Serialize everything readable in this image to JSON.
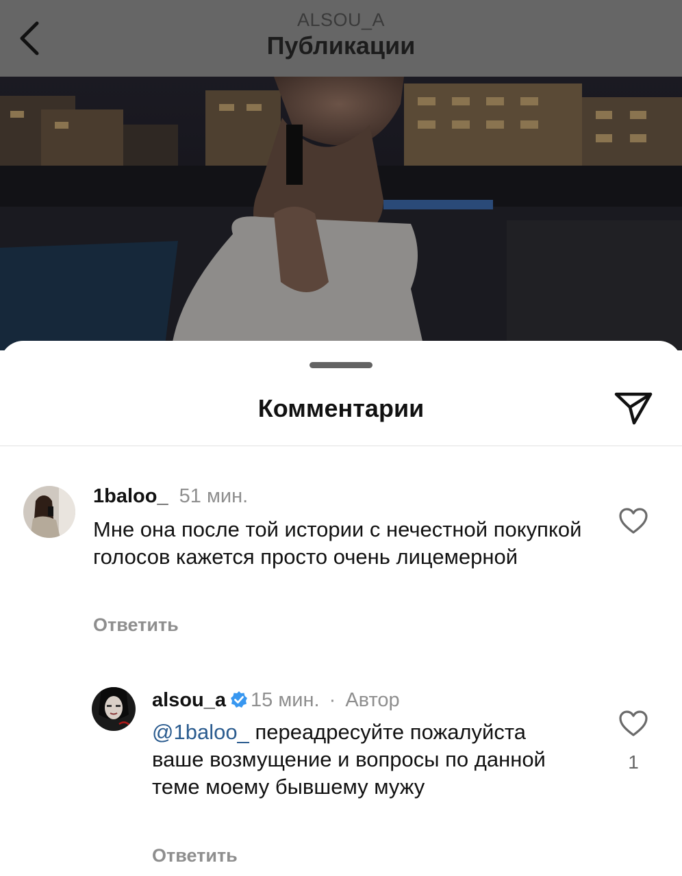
{
  "header": {
    "username": "ALSOU_A",
    "title": "Публикации"
  },
  "sheet": {
    "title": "Комментарии"
  },
  "comments": [
    {
      "username": "1baloo_",
      "time": "51 мин.",
      "text": "Мне она после той истории с нечестной покупкой голосов кажется просто очень лицемерной",
      "reply_label": "Ответить",
      "icon": "heart-outline-icon"
    }
  ],
  "replies": [
    {
      "username": "alsou_a",
      "verified": true,
      "time": "15 мин.",
      "separator": "·",
      "badge": "Автор",
      "mention": "@1baloo_",
      "text": "переадресуйте пожалуйста ваше возмущение и вопросы по данной теме моему бывшему мужу",
      "reply_label": "Ответить",
      "like_count": "1",
      "icon": "heart-outline-icon"
    }
  ],
  "colors": {
    "header_bg": "#666666",
    "mention": "#2b5c8f",
    "verified": "#3897f0",
    "muted_text": "#8e8e8e"
  }
}
